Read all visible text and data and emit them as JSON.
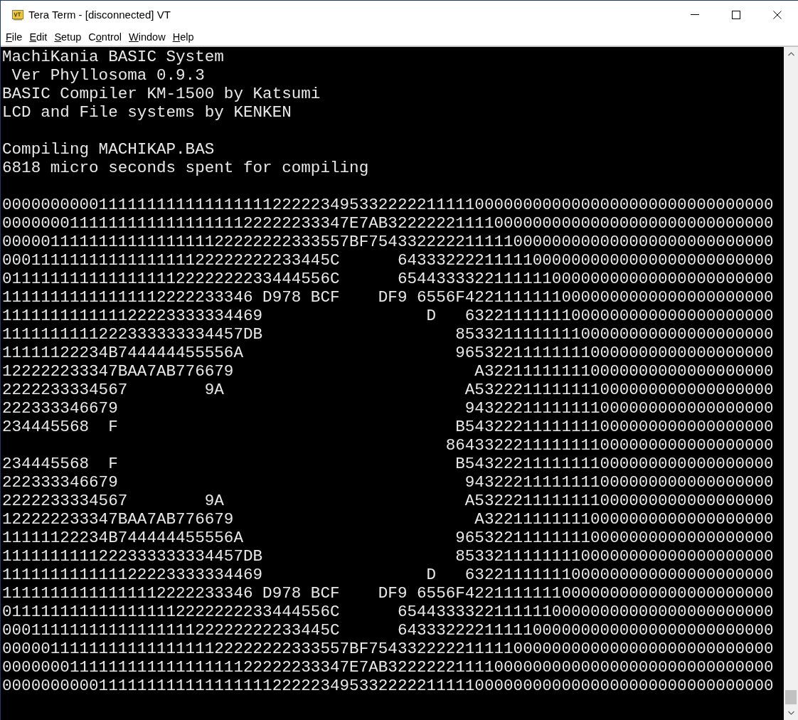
{
  "window": {
    "title": "Tera Term - [disconnected] VT"
  },
  "menu": [
    {
      "key": "F",
      "after": "ile"
    },
    {
      "key": "E",
      "after": "dit"
    },
    {
      "key": "S",
      "after": "etup"
    },
    {
      "before": "C",
      "key": "o",
      "after": "ntrol"
    },
    {
      "key": "W",
      "after": "indow"
    },
    {
      "key": "H",
      "after": "elp"
    }
  ],
  "terminal": {
    "blocks": [
      [
        "MachiKania BASIC System",
        " Ver Phyllosoma 0.9.3",
        "BASIC Compiler KM-1500 by Katsumi",
        "LCD and File systems by KENKEN"
      ],
      [
        "Compiling MACHIKAP.BAS",
        "6818 micro seconds spent for compiling"
      ],
      [
        "00000000001111111111111111112222234953322222111110000000000000000000000000000000",
        "000000011111111111111111122222233347E7AB3222222111100000000000000000000000000000",
        "000001111111111111111122222222333557BF754332222211111000000000000000000000000000",
        "0001111111111111111122222222233445C      643332222111110000000000000000000000000",
        "0111111111111111112222222233444556C      654433332211111100000000000000000000000",
        "11111111111111112222233346 D978 BCF    DF9 6556F42211111110000000000000000000000",
        "111111111111122223333334469                 D   63221111111000000000000000000000",
        "1111111111222333333334457DB                    853321111111100000000000000000000",
        "11111122234B744444455556A                      965322111111110000000000000000000",
        "122222233347BAA7AB776679                         A322111111110000000000000000000",
        "2222233334567        9A                         A5322211111111000000000000000000",
        "222333346679                                    94322211111111000000000000000000",
        "234445568  F                                   B54322211111111000000000000000000",
        "                                              8643322211111111000000000000000000",
        "234445568  F                                   B54322211111111000000000000000000",
        "222333346679                                    94322211111111000000000000000000",
        "2222233334567        9A                         A5322211111111000000000000000000",
        "122222233347BAA7AB776679                         A322111111110000000000000000000",
        "11111122234B744444455556A                      965322111111110000000000000000000",
        "1111111111222333333334457DB                    853321111111100000000000000000000",
        "111111111111122223333334469                 D   63221111111000000000000000000000",
        "11111111111111112222233346 D978 BCF    DF9 6556F42211111110000000000000000000000",
        "0111111111111111112222222233444556C      654433332211111100000000000000000000000",
        "0001111111111111111122222222233445C      643332222111110000000000000000000000000",
        "000001111111111111111122222222333557BF754332222211111000000000000000000000000000",
        "000000011111111111111111122222233347E7AB3222222111100000000000000000000000000000",
        "00000000001111111111111111112222234953322222111110000000000000000000000000000000"
      ]
    ]
  }
}
